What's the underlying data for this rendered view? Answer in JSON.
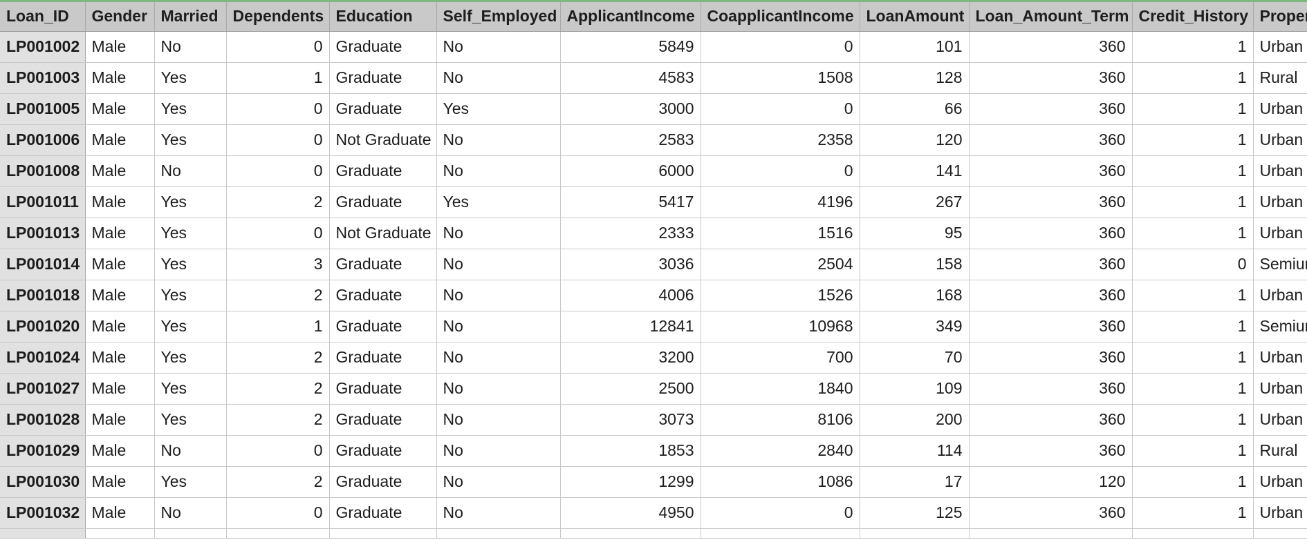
{
  "columns": [
    "Loan_ID",
    "Gender",
    "Married",
    "Dependents",
    "Education",
    "Self_Employed",
    "ApplicantIncome",
    "CoapplicantIncome",
    "LoanAmount",
    "Loan_Amount_Term",
    "Credit_History",
    "Proper"
  ],
  "rows": [
    [
      "LP001002",
      "Male",
      "No",
      "0",
      "Graduate",
      "No",
      "5849",
      "0",
      "101",
      "360",
      "1",
      "Urban"
    ],
    [
      "LP001003",
      "Male",
      "Yes",
      "1",
      "Graduate",
      "No",
      "4583",
      "1508",
      "128",
      "360",
      "1",
      "Rural"
    ],
    [
      "LP001005",
      "Male",
      "Yes",
      "0",
      "Graduate",
      "Yes",
      "3000",
      "0",
      "66",
      "360",
      "1",
      "Urban"
    ],
    [
      "LP001006",
      "Male",
      "Yes",
      "0",
      "Not Graduate",
      "No",
      "2583",
      "2358",
      "120",
      "360",
      "1",
      "Urban"
    ],
    [
      "LP001008",
      "Male",
      "No",
      "0",
      "Graduate",
      "No",
      "6000",
      "0",
      "141",
      "360",
      "1",
      "Urban"
    ],
    [
      "LP001011",
      "Male",
      "Yes",
      "2",
      "Graduate",
      "Yes",
      "5417",
      "4196",
      "267",
      "360",
      "1",
      "Urban"
    ],
    [
      "LP001013",
      "Male",
      "Yes",
      "0",
      "Not Graduate",
      "No",
      "2333",
      "1516",
      "95",
      "360",
      "1",
      "Urban"
    ],
    [
      "LP001014",
      "Male",
      "Yes",
      "3",
      "Graduate",
      "No",
      "3036",
      "2504",
      "158",
      "360",
      "0",
      "Semiur"
    ],
    [
      "LP001018",
      "Male",
      "Yes",
      "2",
      "Graduate",
      "No",
      "4006",
      "1526",
      "168",
      "360",
      "1",
      "Urban"
    ],
    [
      "LP001020",
      "Male",
      "Yes",
      "1",
      "Graduate",
      "No",
      "12841",
      "10968",
      "349",
      "360",
      "1",
      "Semiur"
    ],
    [
      "LP001024",
      "Male",
      "Yes",
      "2",
      "Graduate",
      "No",
      "3200",
      "700",
      "70",
      "360",
      "1",
      "Urban"
    ],
    [
      "LP001027",
      "Male",
      "Yes",
      "2",
      "Graduate",
      "No",
      "2500",
      "1840",
      "109",
      "360",
      "1",
      "Urban"
    ],
    [
      "LP001028",
      "Male",
      "Yes",
      "2",
      "Graduate",
      "No",
      "3073",
      "8106",
      "200",
      "360",
      "1",
      "Urban"
    ],
    [
      "LP001029",
      "Male",
      "No",
      "0",
      "Graduate",
      "No",
      "1853",
      "2840",
      "114",
      "360",
      "1",
      "Rural"
    ],
    [
      "LP001030",
      "Male",
      "Yes",
      "2",
      "Graduate",
      "No",
      "1299",
      "1086",
      "17",
      "120",
      "1",
      "Urban"
    ],
    [
      "LP001032",
      "Male",
      "No",
      "0",
      "Graduate",
      "No",
      "4950",
      "0",
      "125",
      "360",
      "1",
      "Urban"
    ]
  ],
  "colors": {
    "header_bg": "#c9c9c9",
    "id_column_bg": "#e1e1e1",
    "grid_line": "#c8c8c8",
    "top_accent": "#7fb87f"
  }
}
